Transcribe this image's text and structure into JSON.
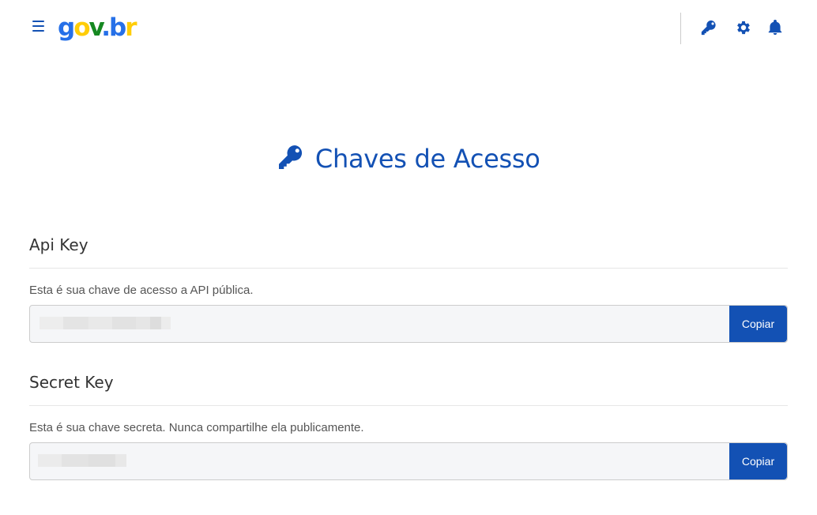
{
  "header": {
    "logo": {
      "g": "g",
      "o": "o",
      "v": "v",
      "dot": ".",
      "b": "b",
      "r": "r",
      "full": "gov.br"
    },
    "icons": [
      "key-icon",
      "gear-icon",
      "bell-icon"
    ]
  },
  "page": {
    "title": "Chaves de Acesso"
  },
  "api_key": {
    "heading": "Api Key",
    "description": "Esta é sua chave de acesso a API pública.",
    "copy_label": "Copiar"
  },
  "secret_key": {
    "heading": "Secret Key",
    "description": "Esta é sua chave secreta. Nunca compartilhe ela publicamente.",
    "copy_label": "Copiar"
  },
  "colors": {
    "primary": "#1351b4",
    "logo_blue": "#2670e8",
    "logo_yellow": "#ffcd07",
    "logo_green": "#168821",
    "field_bg": "#f5f6f8"
  }
}
